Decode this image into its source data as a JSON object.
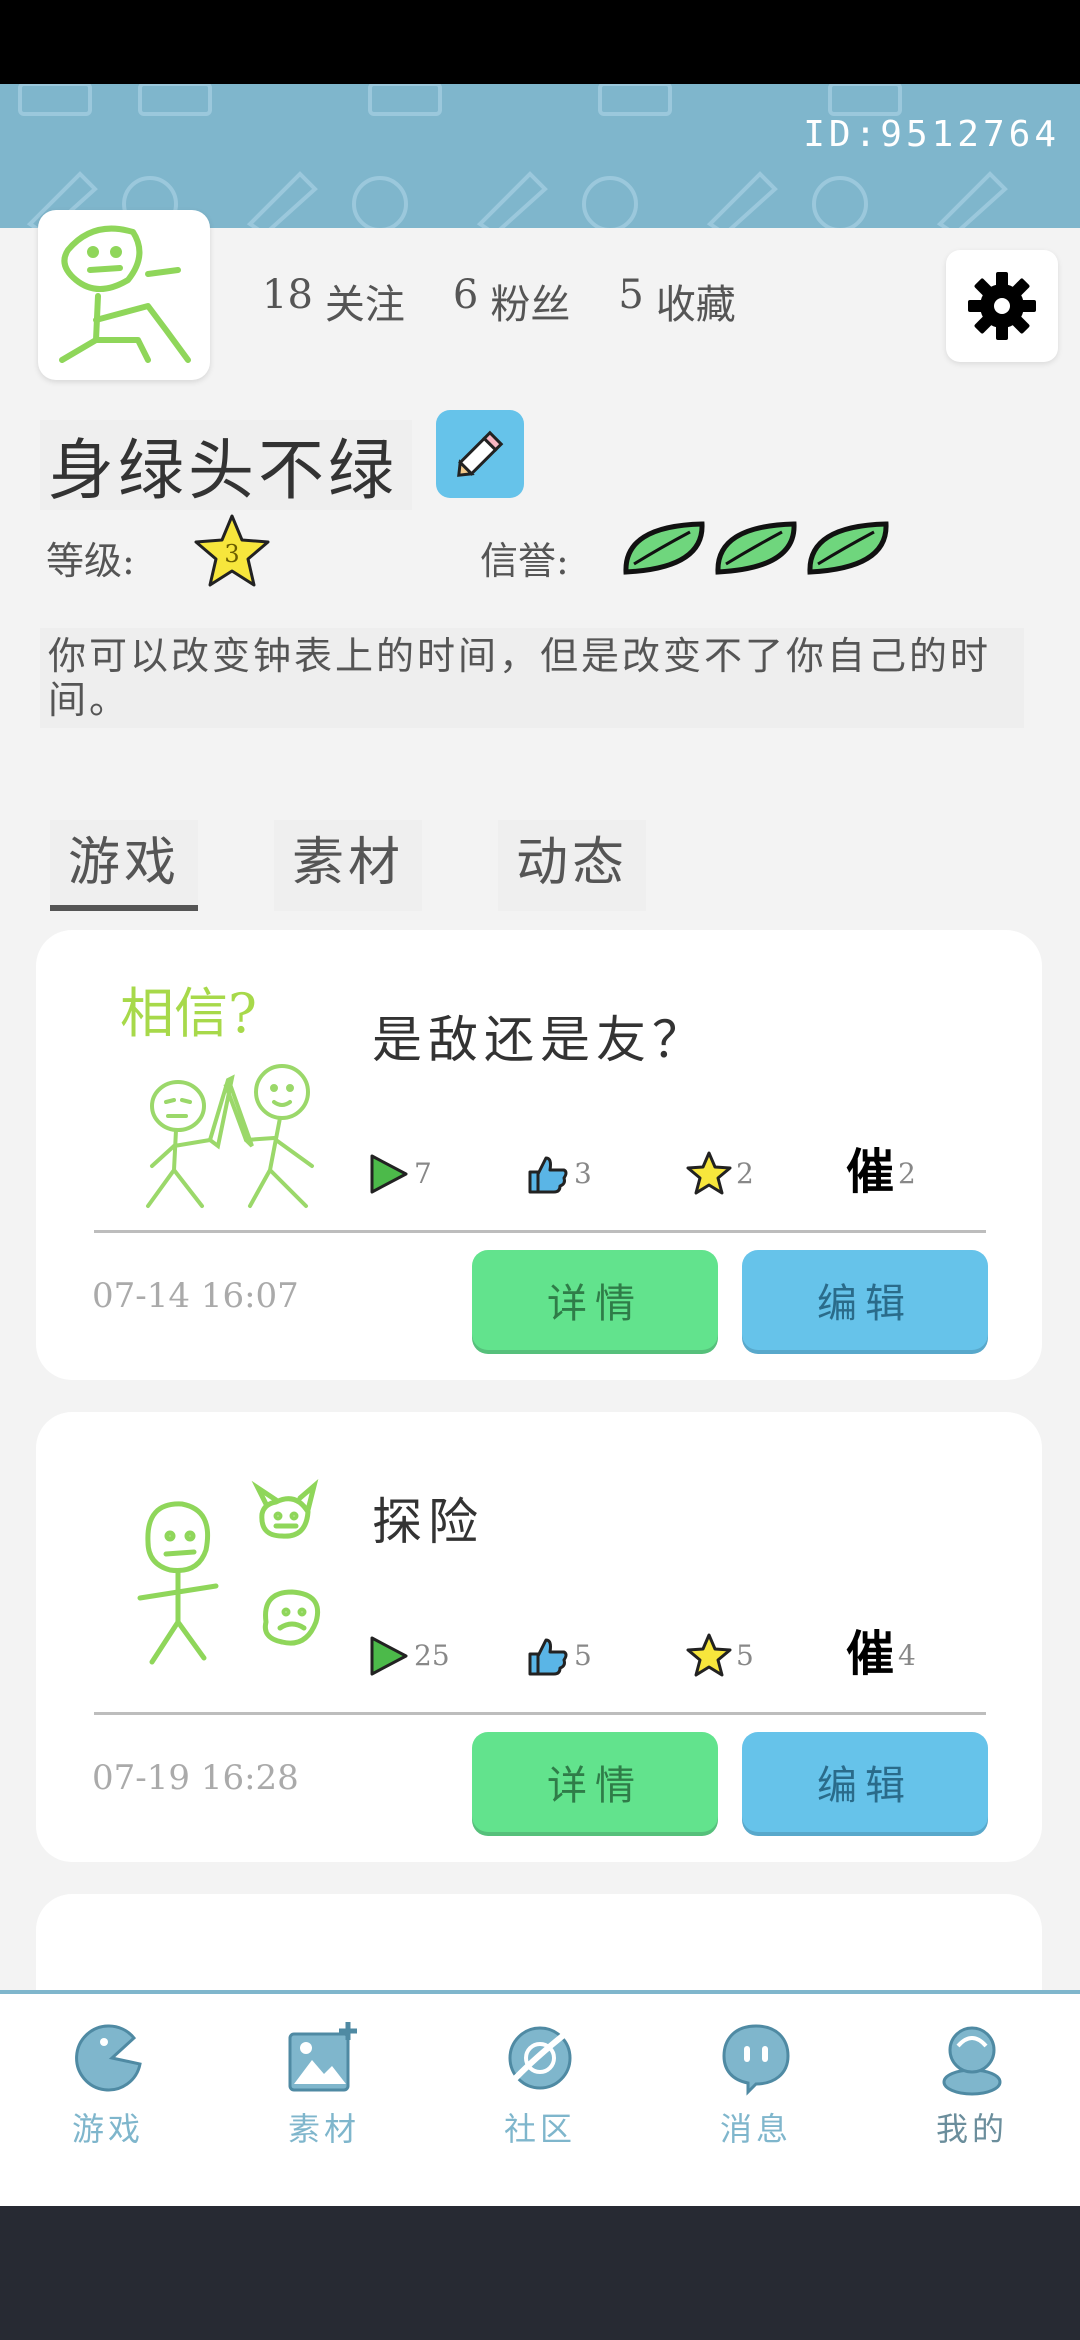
{
  "header": {
    "user_id": "ID:9512764"
  },
  "profile": {
    "stats": [
      {
        "count": "18",
        "label": "关注"
      },
      {
        "count": "6",
        "label": "粉丝"
      },
      {
        "count": "5",
        "label": "收藏"
      }
    ],
    "username": "身绿头不绿",
    "level_label": "等级:",
    "level_value": "3",
    "reputation_label": "信誉:",
    "reputation_level": 3,
    "bio": "你可以改变钟表上的时间，但是改变不了你自己的时间。"
  },
  "tabs": [
    {
      "label": "游戏",
      "active": true
    },
    {
      "label": "素材",
      "active": false
    },
    {
      "label": "动态",
      "active": false
    }
  ],
  "games": [
    {
      "title": "是敌还是友？",
      "thumbnail_caption": "相信?",
      "plays": "7",
      "likes": "3",
      "favorites": "2",
      "urges": "2",
      "date": "07-14 16:07",
      "detail_label": "详情",
      "edit_label": "编辑"
    },
    {
      "title": "探险",
      "plays": "25",
      "likes": "5",
      "favorites": "5",
      "urges": "4",
      "date": "07-19 16:28",
      "detail_label": "详情",
      "edit_label": "编辑"
    }
  ],
  "urge_glyph": "催",
  "bottom_nav": [
    {
      "label": "游戏",
      "icon": "game-icon"
    },
    {
      "label": "素材",
      "icon": "image-add-icon"
    },
    {
      "label": "社区",
      "icon": "planet-icon"
    },
    {
      "label": "消息",
      "icon": "message-icon"
    },
    {
      "label": "我的",
      "icon": "profile-icon",
      "active": true
    }
  ],
  "colors": {
    "accent_blue": "#66c3ea",
    "accent_green": "#62e38d",
    "banner": "#7fb6cc",
    "doodle_green": "#8fd65a"
  }
}
